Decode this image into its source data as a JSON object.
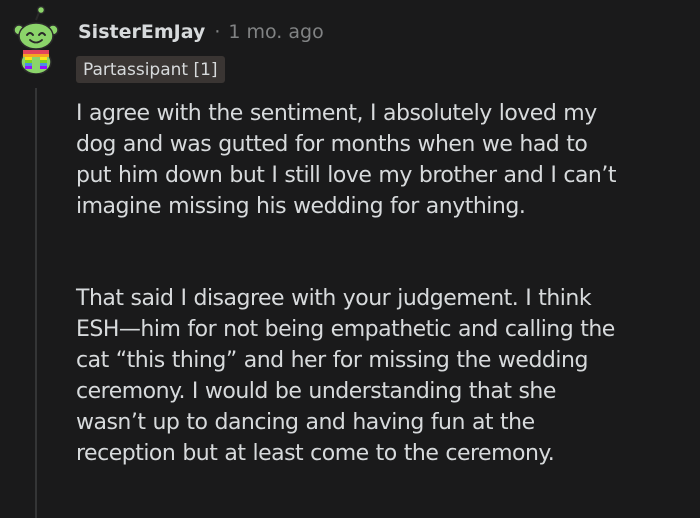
{
  "comment": {
    "author": "SisterEmJay",
    "separator": "·",
    "timestamp": "1 mo. ago",
    "flair": "Partassipant [1]",
    "paragraphs": [
      {
        "lines": [
          "I agree with the sentiment, I absolutely loved my",
          "dog and was gutted for months when we had to",
          "put him down but I still love my brother and I can’t",
          "imagine missing his wedding for anything."
        ]
      },
      {
        "lines": [
          "That said I disagree with your judgement. I think",
          "ESH—him for not being empathetic and calling the",
          "cat “this thing” and her for missing the wedding",
          "ceremony. I would be understanding that she",
          "wasn’t up to dancing and having fun at the",
          "reception but at least come to the ceremony."
        ]
      }
    ]
  },
  "avatar": {
    "icon": "snoo-avatar-icon",
    "face_color": "#8bd46a",
    "scarf_colors": [
      "#e2445c",
      "#f5a623",
      "#f8e71c",
      "#7ed321",
      "#4a90e2",
      "#9013fe"
    ]
  },
  "colors": {
    "background": "#1a1a1b",
    "text_primary": "#d7dadc",
    "text_muted": "#818384",
    "flair_bg": "#3a3533",
    "thread_line": "#343536"
  }
}
